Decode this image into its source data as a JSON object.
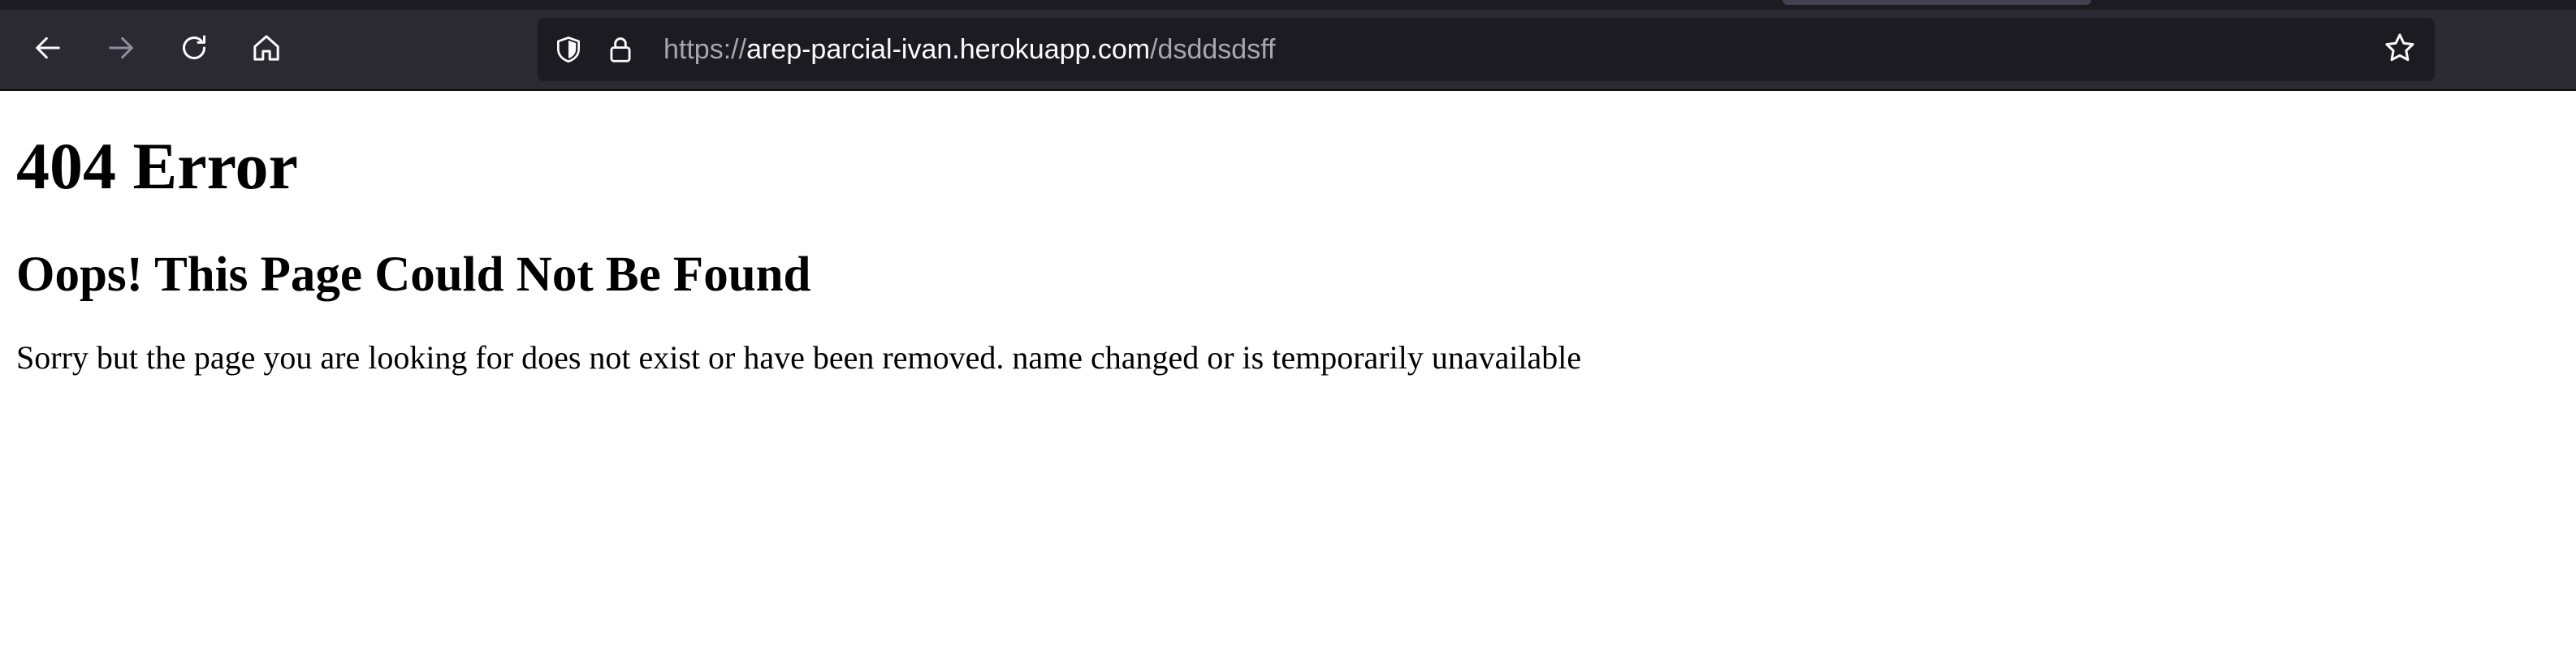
{
  "browser": {
    "url": {
      "scheme": "https://",
      "host": "arep-parcial-ivan.herokuapp.com",
      "path": "/dsddsdsff"
    },
    "icons": {
      "back": "back-arrow-icon",
      "forward": "forward-arrow-icon",
      "reload": "reload-icon",
      "home": "home-icon",
      "tracking_protection": "shield-icon",
      "security": "lock-icon",
      "bookmark": "star-icon"
    },
    "colors": {
      "toolbar": "#2b2a33",
      "urlbar": "#1c1b22",
      "url_host": "#fbfbfe",
      "url_dim": "#a7a6ae"
    }
  },
  "page": {
    "heading": "404 Error",
    "subheading": "Oops! This Page Could Not Be Found",
    "message": "Sorry but the page you are looking for does not exist or have been removed. name changed or is temporarily unavailable"
  }
}
